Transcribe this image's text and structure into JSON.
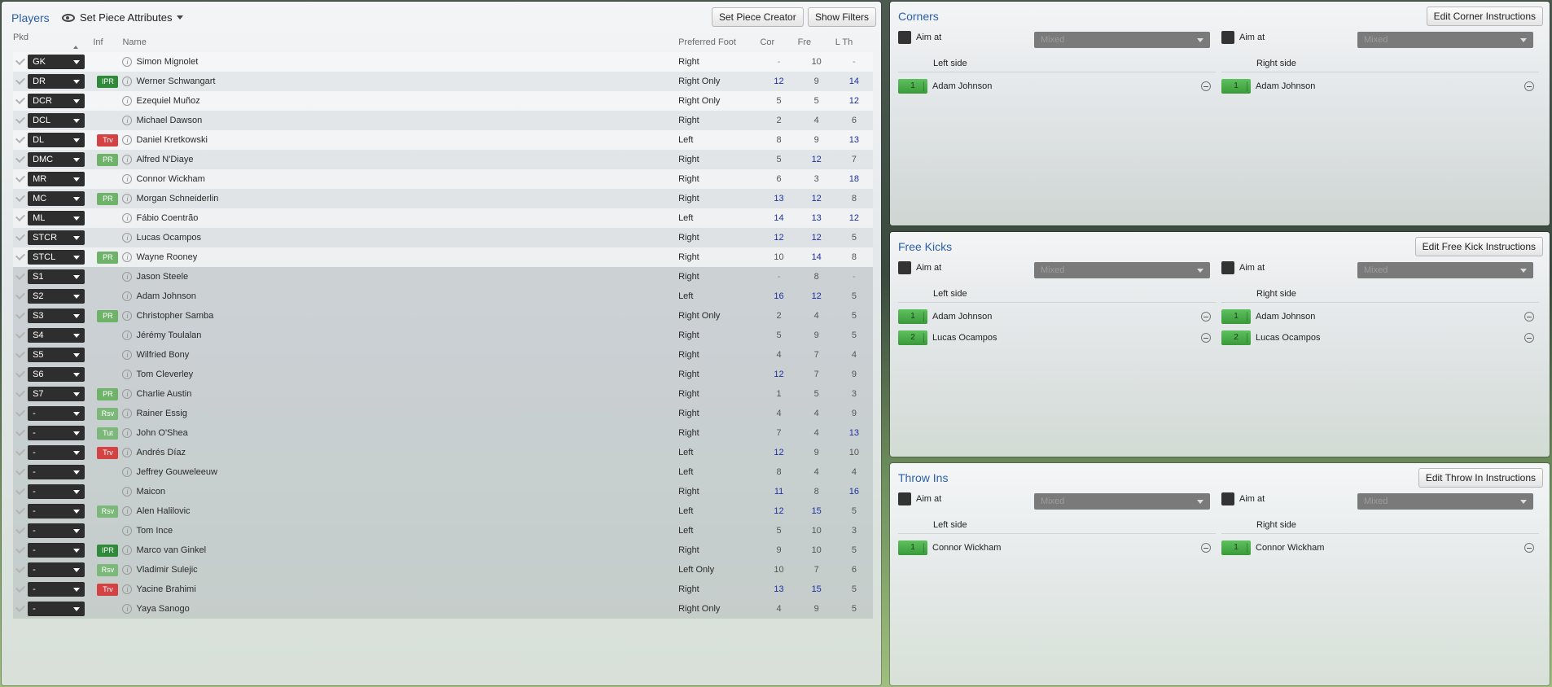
{
  "players_panel": {
    "title": "Players",
    "view": "Set Piece Attributes",
    "buttons": {
      "creator": "Set Piece Creator",
      "filters": "Show Filters"
    },
    "columns": {
      "pkd": "Pkd",
      "inf": "Inf",
      "name": "Name",
      "foot": "Preferred Foot",
      "cor": "Cor",
      "fre": "Fre",
      "lth": "L Th"
    },
    "rows": [
      {
        "pos": "GK",
        "inf": "",
        "name": "Simon Mignolet",
        "foot": "Right",
        "cor": "-",
        "fre": "10",
        "lth": "-",
        "hi": []
      },
      {
        "pos": "DR",
        "inf": "IPR",
        "name": "Werner Schwangart",
        "foot": "Right Only",
        "cor": "12",
        "fre": "9",
        "lth": "14",
        "hi": [
          "cor",
          "lth"
        ]
      },
      {
        "pos": "DCR",
        "inf": "",
        "name": "Ezequiel Muñoz",
        "foot": "Right Only",
        "cor": "5",
        "fre": "5",
        "lth": "12",
        "hi": [
          "lth"
        ]
      },
      {
        "pos": "DCL",
        "inf": "",
        "name": "Michael Dawson",
        "foot": "Right",
        "cor": "2",
        "fre": "4",
        "lth": "6",
        "hi": []
      },
      {
        "pos": "DL",
        "inf": "Trv",
        "name": "Daniel Kretkowski",
        "foot": "Left",
        "cor": "8",
        "fre": "9",
        "lth": "13",
        "hi": [
          "lth"
        ]
      },
      {
        "pos": "DMC",
        "inf": "PR",
        "name": "Alfred N'Diaye",
        "foot": "Right",
        "cor": "5",
        "fre": "12",
        "lth": "7",
        "hi": [
          "fre"
        ]
      },
      {
        "pos": "MR",
        "inf": "",
        "name": "Connor Wickham",
        "foot": "Right",
        "cor": "6",
        "fre": "3",
        "lth": "18",
        "hi": [
          "lth"
        ]
      },
      {
        "pos": "MC",
        "inf": "PR",
        "name": "Morgan Schneiderlin",
        "foot": "Right",
        "cor": "13",
        "fre": "12",
        "lth": "8",
        "hi": [
          "cor",
          "fre"
        ]
      },
      {
        "pos": "ML",
        "inf": "",
        "name": "Fábio Coentrão",
        "foot": "Left",
        "cor": "14",
        "fre": "13",
        "lth": "12",
        "hi": [
          "cor",
          "fre",
          "lth"
        ]
      },
      {
        "pos": "STCR",
        "inf": "",
        "name": "Lucas Ocampos",
        "foot": "Right",
        "cor": "12",
        "fre": "12",
        "lth": "5",
        "hi": [
          "cor",
          "fre"
        ]
      },
      {
        "pos": "STCL",
        "inf": "PR",
        "name": "Wayne Rooney",
        "foot": "Right",
        "cor": "10",
        "fre": "14",
        "lth": "8",
        "hi": [
          "fre"
        ]
      },
      {
        "pos": "S1",
        "inf": "",
        "name": "Jason Steele",
        "foot": "Right",
        "cor": "-",
        "fre": "8",
        "lth": "-",
        "hi": []
      },
      {
        "pos": "S2",
        "inf": "",
        "name": "Adam Johnson",
        "foot": "Left",
        "cor": "16",
        "fre": "12",
        "lth": "5",
        "hi": [
          "cor",
          "fre"
        ]
      },
      {
        "pos": "S3",
        "inf": "PR",
        "name": "Christopher Samba",
        "foot": "Right Only",
        "cor": "2",
        "fre": "4",
        "lth": "5",
        "hi": []
      },
      {
        "pos": "S4",
        "inf": "",
        "name": "Jérémy Toulalan",
        "foot": "Right",
        "cor": "5",
        "fre": "9",
        "lth": "5",
        "hi": []
      },
      {
        "pos": "S5",
        "inf": "",
        "name": "Wilfried Bony",
        "foot": "Right",
        "cor": "4",
        "fre": "7",
        "lth": "4",
        "hi": []
      },
      {
        "pos": "S6",
        "inf": "",
        "name": "Tom Cleverley",
        "foot": "Right",
        "cor": "12",
        "fre": "7",
        "lth": "9",
        "hi": [
          "cor"
        ]
      },
      {
        "pos": "S7",
        "inf": "PR",
        "name": "Charlie Austin",
        "foot": "Right",
        "cor": "1",
        "fre": "5",
        "lth": "3",
        "hi": []
      },
      {
        "pos": "-",
        "inf": "Rsv",
        "name": "Rainer Essig",
        "foot": "Right",
        "cor": "4",
        "fre": "4",
        "lth": "9",
        "hi": []
      },
      {
        "pos": "-",
        "inf": "Tut",
        "name": "John O'Shea",
        "foot": "Right",
        "cor": "7",
        "fre": "4",
        "lth": "13",
        "hi": [
          "lth"
        ]
      },
      {
        "pos": "-",
        "inf": "Trv",
        "name": "Andrés Díaz",
        "foot": "Left",
        "cor": "12",
        "fre": "9",
        "lth": "10",
        "hi": [
          "cor"
        ]
      },
      {
        "pos": "-",
        "inf": "",
        "name": "Jeffrey Gouweleeuw",
        "foot": "Left",
        "cor": "8",
        "fre": "4",
        "lth": "4",
        "hi": []
      },
      {
        "pos": "-",
        "inf": "",
        "name": "Maicon",
        "foot": "Right",
        "cor": "11",
        "fre": "8",
        "lth": "16",
        "hi": [
          "cor",
          "lth"
        ]
      },
      {
        "pos": "-",
        "inf": "Rsv",
        "name": "Alen Halilovic",
        "foot": "Left",
        "cor": "12",
        "fre": "15",
        "lth": "5",
        "hi": [
          "cor",
          "fre"
        ]
      },
      {
        "pos": "-",
        "inf": "",
        "name": "Tom Ince",
        "foot": "Left",
        "cor": "5",
        "fre": "10",
        "lth": "3",
        "hi": []
      },
      {
        "pos": "-",
        "inf": "IPR",
        "name": "Marco van Ginkel",
        "foot": "Right",
        "cor": "9",
        "fre": "10",
        "lth": "5",
        "hi": []
      },
      {
        "pos": "-",
        "inf": "Rsv",
        "name": "Vladimir Sulejic",
        "foot": "Left Only",
        "cor": "10",
        "fre": "7",
        "lth": "6",
        "hi": []
      },
      {
        "pos": "-",
        "inf": "Trv",
        "name": "Yacine Brahimi",
        "foot": "Right",
        "cor": "13",
        "fre": "15",
        "lth": "5",
        "hi": [
          "cor",
          "fre"
        ]
      },
      {
        "pos": "-",
        "inf": "",
        "name": "Yaya Sanogo",
        "foot": "Right Only",
        "cor": "4",
        "fre": "9",
        "lth": "5",
        "hi": []
      }
    ]
  },
  "set_pieces": [
    {
      "id": "corners",
      "title": "Corners",
      "button": "Edit Corner Instructions",
      "aim_label": "Aim at",
      "mixed": "Mixed",
      "left_label": "Left side",
      "right_label": "Right side",
      "left": [
        {
          "n": "1",
          "name": "Adam Johnson"
        }
      ],
      "right": [
        {
          "n": "1",
          "name": "Adam Johnson"
        }
      ]
    },
    {
      "id": "freekicks",
      "title": "Free Kicks",
      "button": "Edit Free Kick Instructions",
      "aim_label": "Aim at",
      "mixed": "Mixed",
      "left_label": "Left side",
      "right_label": "Right side",
      "left": [
        {
          "n": "1",
          "name": "Adam Johnson"
        },
        {
          "n": "2",
          "name": "Lucas Ocampos"
        }
      ],
      "right": [
        {
          "n": "1",
          "name": "Adam Johnson"
        },
        {
          "n": "2",
          "name": "Lucas Ocampos"
        }
      ]
    },
    {
      "id": "throwins",
      "title": "Throw Ins",
      "button": "Edit Throw In Instructions",
      "aim_label": "Aim at",
      "mixed": "Mixed",
      "left_label": "Left side",
      "right_label": "Right side",
      "left": [
        {
          "n": "1",
          "name": "Connor Wickham"
        }
      ],
      "right": [
        {
          "n": "1",
          "name": "Connor Wickham"
        }
      ]
    }
  ]
}
